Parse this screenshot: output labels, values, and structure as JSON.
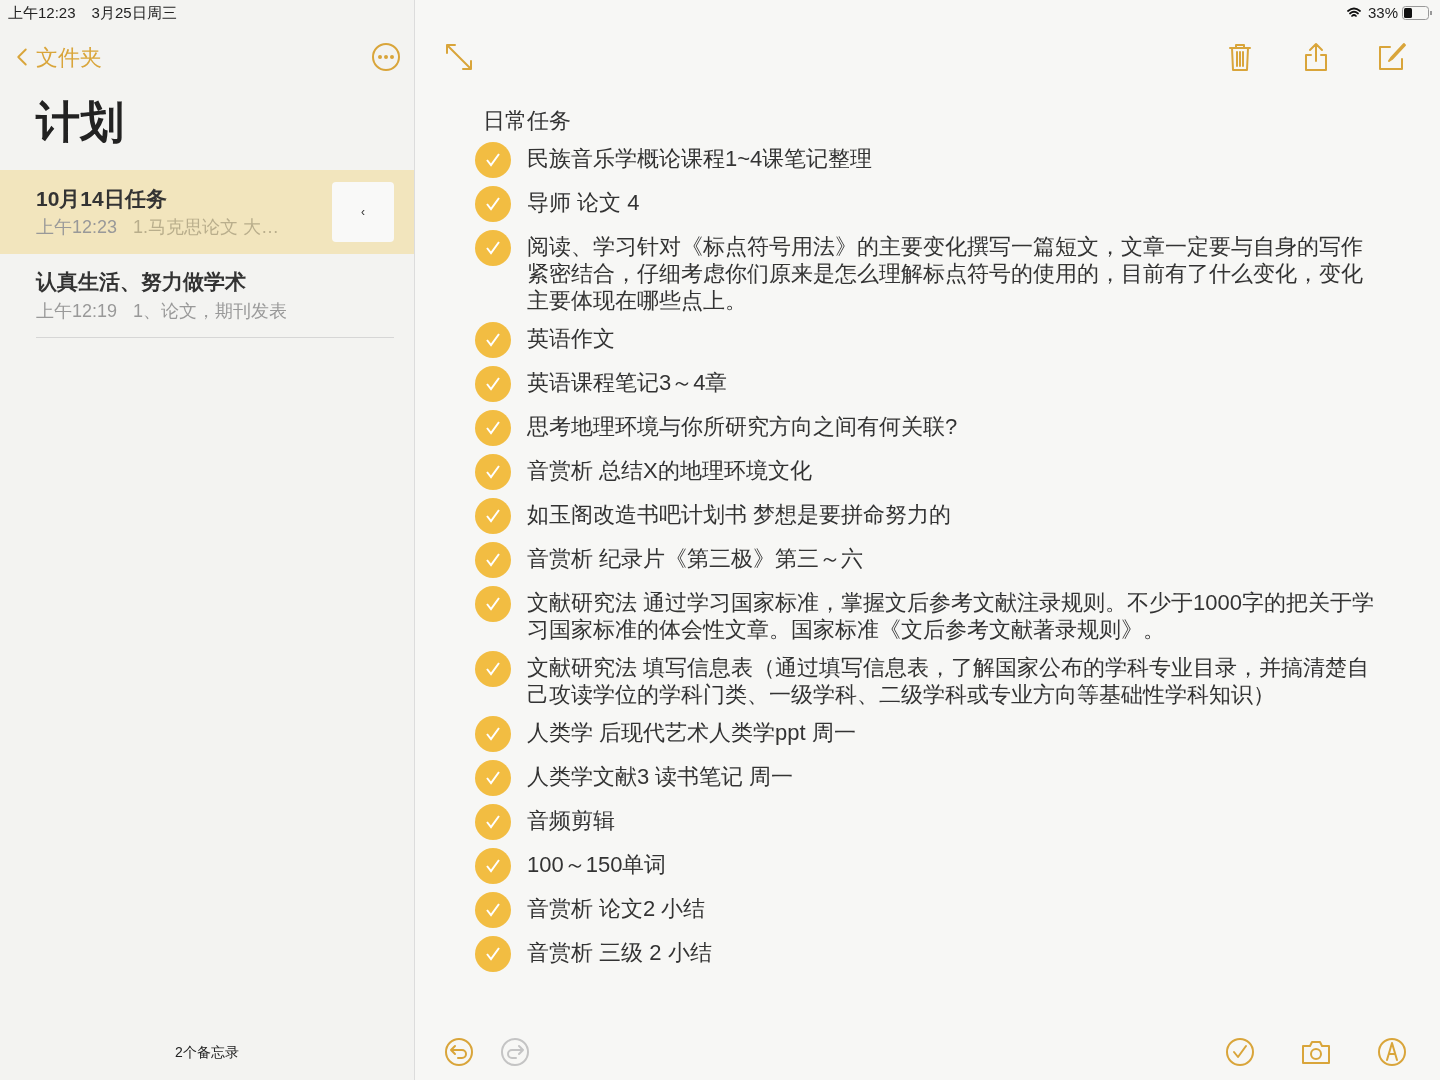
{
  "status_bar": {
    "time": "上午12:23",
    "date": "3月25日周三",
    "battery": "33%"
  },
  "sidebar": {
    "back": "文件夹",
    "title": "计划",
    "notes": [
      {
        "title": "10月14日任务",
        "time": "上午12:23",
        "preview": "1.马克思论文 大…",
        "selected": true,
        "action": "‹"
      },
      {
        "title": "认真生活、努力做学术",
        "time": "上午12:19",
        "preview": "1、论文，期刊发表",
        "selected": false
      }
    ],
    "count": "2个备忘录"
  },
  "note": {
    "heading": "日常任务",
    "items": [
      {
        "text": "民族音乐学概论课程1~4课笔记整理",
        "checked": true
      },
      {
        "text": "导师 论文 4",
        "checked": true
      },
      {
        "text": "阅读、学习针对《标点符号用法》的主要变化撰写一篇短文，文章一定要与自身的写作紧密结合，仔细考虑你们原来是怎么理解标点符号的使用的，目前有了什么变化，变化主要体现在哪些点上。",
        "checked": true
      },
      {
        "text": "英语作文",
        "checked": true
      },
      {
        "text": "英语课程笔记3～4章",
        "checked": true
      },
      {
        "text": "思考地理环境与你所研究方向之间有何关联?",
        "checked": true
      },
      {
        "text": "音赏析 总结X的地理环境文化",
        "checked": true
      },
      {
        "text": "如玉阁改造书吧计划书 梦想是要拼命努力的",
        "checked": true
      },
      {
        "text": "音赏析 纪录片《第三极》第三～六",
        "checked": true
      },
      {
        "text": "文献研究法 通过学习国家标准，掌握文后参考文献注录规则。不少于1000字的把关于学习国家标准的体会性文章。国家标准《文后参考文献著录规则》。",
        "checked": true
      },
      {
        "text": "文献研究法 填写信息表（通过填写信息表，了解国家公布的学科专业目录，并搞清楚自己攻读学位的学科门类、一级学科、二级学科或专业方向等基础性学科知识）",
        "checked": true
      },
      {
        "text": "人类学 后现代艺术人类学ppt 周一",
        "checked": true
      },
      {
        "text": "人类学文献3 读书笔记 周一",
        "checked": true
      },
      {
        "text": "音频剪辑",
        "checked": true
      },
      {
        "text": "100～150单词",
        "checked": true
      },
      {
        "text": "音赏析 论文2  小结",
        "checked": true
      },
      {
        "text": "音赏析 三级 2 小结",
        "checked": true
      }
    ]
  },
  "toolbar": {
    "redo_disabled": true
  }
}
